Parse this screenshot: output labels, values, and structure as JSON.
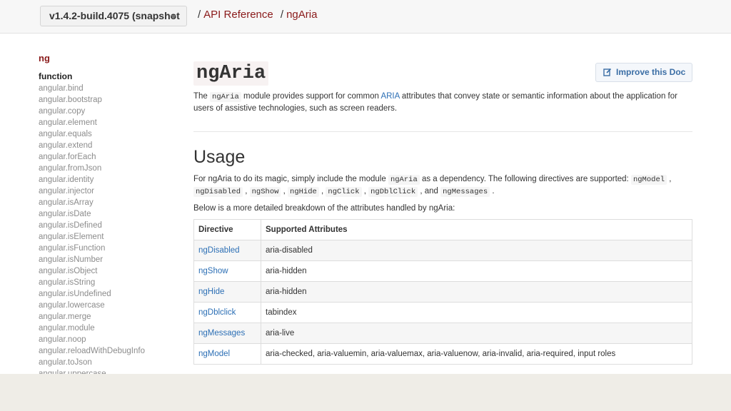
{
  "topbar": {
    "version": "v1.4.2-build.4075 (snapshot",
    "breadcrumb": [
      "API Reference",
      "ngAria"
    ]
  },
  "sidebar": {
    "section": "ng",
    "group": "function",
    "items": [
      "angular.bind",
      "angular.bootstrap",
      "angular.copy",
      "angular.element",
      "angular.equals",
      "angular.extend",
      "angular.forEach",
      "angular.fromJson",
      "angular.identity",
      "angular.injector",
      "angular.isArray",
      "angular.isDate",
      "angular.isDefined",
      "angular.isElement",
      "angular.isFunction",
      "angular.isNumber",
      "angular.isObject",
      "angular.isString",
      "angular.isUndefined",
      "angular.lowercase",
      "angular.merge",
      "angular.module",
      "angular.noop",
      "angular.reloadWithDebugInfo",
      "angular.toJson",
      "angular.uppercase"
    ]
  },
  "main": {
    "title": "ngAria",
    "improve_label": "Improve this Doc",
    "intro": {
      "t1": "The ",
      "code": "ngAria",
      "t2": " module provides support for common ",
      "link": "ARIA",
      "t3": " attributes that convey state or semantic information about the application for users of assistive technologies, such as screen readers."
    },
    "usage_heading": "Usage",
    "usage": {
      "t1": "For ngAria to do its magic, simply include the module ",
      "c1": "ngAria",
      "t2": " as a dependency. The following directives are supported: ",
      "c2": "ngModel",
      "s1": " , ",
      "c3": "ngDisabled",
      "s2": " , ",
      "c4": "ngShow",
      "s3": " , ",
      "c5": "ngHide",
      "s4": " , ",
      "c6": "ngClick",
      "s5": " , ",
      "c7": "ngDblClick",
      "s6": " , and ",
      "c8": "ngMessages",
      "s7": " ."
    },
    "breakdown": "Below is a more detailed breakdown of the attributes handled by ngAria:",
    "table": {
      "headers": [
        "Directive",
        "Supported Attributes"
      ],
      "rows": [
        {
          "directive": "ngDisabled",
          "attrs": "aria-disabled"
        },
        {
          "directive": "ngShow",
          "attrs": "aria-hidden"
        },
        {
          "directive": "ngHide",
          "attrs": "aria-hidden"
        },
        {
          "directive": "ngDblclick",
          "attrs": "tabindex"
        },
        {
          "directive": "ngMessages",
          "attrs": "aria-live"
        },
        {
          "directive": "ngModel",
          "attrs": "aria-checked, aria-valuemin, aria-valuemax, aria-valuenow, aria-invalid, aria-required, input roles"
        }
      ]
    }
  }
}
